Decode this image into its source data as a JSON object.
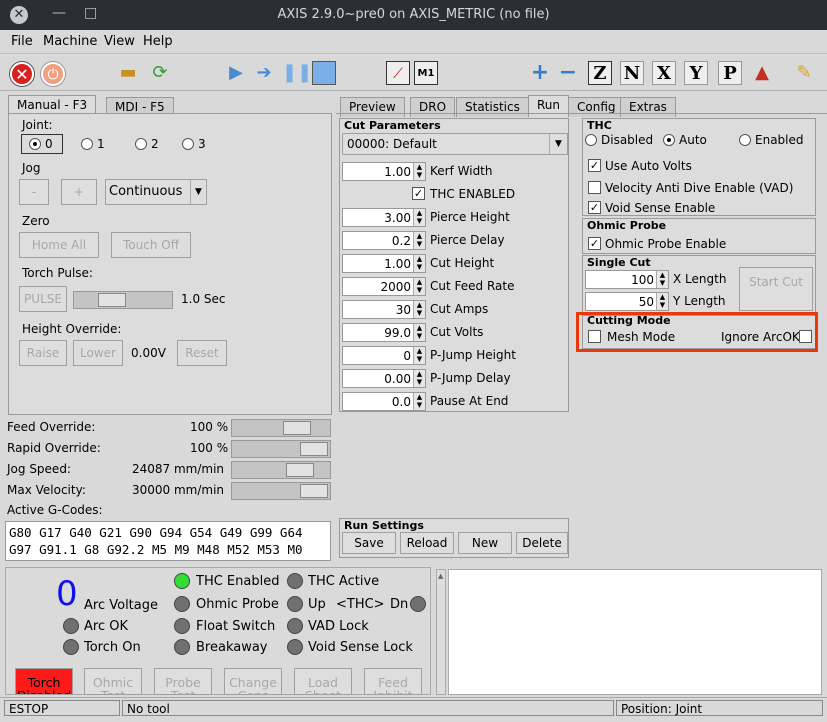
{
  "window": {
    "title": "AXIS 2.9.0~pre0 on AXIS_METRIC (no file)"
  },
  "menu": [
    "File",
    "Machine",
    "View",
    "Help"
  ],
  "toolbar": {
    "icons": [
      "estop-icon",
      "power-icon",
      "open-icon",
      "reload-icon",
      "run-icon",
      "step-icon",
      "pause-icon",
      "stop-icon",
      "touchoff-icon",
      "ml-icon",
      "zoom-in-icon",
      "zoom-out-icon",
      "view-z-icon",
      "view-z2-icon",
      "view-x-icon",
      "view-y-icon",
      "view-p-icon",
      "rotate-icon",
      "clear-icon"
    ],
    "view_labels": {
      "z": "Z",
      "z2": "N",
      "x": "X",
      "y": "Y",
      "p": "P"
    }
  },
  "left_tabs": [
    "Manual - F3",
    "MDI - F5"
  ],
  "manual": {
    "joint_label": "Joint:",
    "joints": [
      "0",
      "1",
      "2",
      "3"
    ],
    "jog_label": "Jog",
    "jog_minus": "-",
    "jog_plus": "+",
    "jog_mode": "Continuous",
    "zero_label": "Zero",
    "home_all": "Home All",
    "touch_off": "Touch Off",
    "torch_pulse_label": "Torch Pulse:",
    "pulse": "PULSE",
    "pulse_time": "1.0 Sec",
    "height_override_label": "Height Override:",
    "raise": "Raise",
    "lower": "Lower",
    "override_value": "0.00V",
    "reset": "Reset"
  },
  "overrides": [
    {
      "label": "Feed Override:",
      "value": "100 %",
      "level": 0.75
    },
    {
      "label": "Rapid Override:",
      "value": "100 %",
      "level": 1.0
    },
    {
      "label": "Jog Speed:",
      "value": "24087 mm/min",
      "level": 0.8
    },
    {
      "label": "Max Velocity:",
      "value": "30000 mm/min",
      "level": 1.0
    }
  ],
  "gcodes": {
    "label": "Active G-Codes:",
    "line1": "G80 G17 G40 G21 G90 G94 G54 G49 G99 G64",
    "line2": "G97 G91.1 G8 G92.2 M5 M9 M48 M52 M53 M0"
  },
  "right_tabs": [
    "Preview",
    "DRO",
    "Statistics",
    "Run",
    "Config",
    "Extras"
  ],
  "cut_params": {
    "title": "Cut Parameters",
    "material": "00000: Default",
    "rows": [
      {
        "value": "1.00",
        "label": "Kerf Width"
      },
      {
        "value": "",
        "label": "THC ENABLED",
        "checkbox": true
      },
      {
        "value": "3.00",
        "label": "Pierce Height"
      },
      {
        "value": "0.2",
        "label": "Pierce Delay"
      },
      {
        "value": "1.00",
        "label": "Cut Height"
      },
      {
        "value": "2000",
        "label": "Cut Feed Rate"
      },
      {
        "value": "30",
        "label": "Cut Amps"
      },
      {
        "value": "99.0",
        "label": "Cut Volts"
      },
      {
        "value": "0",
        "label": "P-Jump Height"
      },
      {
        "value": "0.00",
        "label": "P-Jump Delay"
      },
      {
        "value": "0.0",
        "label": "Pause At End"
      }
    ]
  },
  "run_settings": {
    "title": "Run Settings",
    "buttons": [
      "Save",
      "Reload",
      "New",
      "Delete"
    ]
  },
  "thc": {
    "title": "THC",
    "modes": [
      "Disabled",
      "Auto",
      "Enabled"
    ],
    "selected": "Auto",
    "options": [
      "Use Auto Volts",
      "Velocity Anti Dive Enable (VAD)",
      "Void Sense Enable"
    ],
    "checked": [
      true,
      false,
      true
    ]
  },
  "ohmic": {
    "title": "Ohmic Probe",
    "option": "Ohmic Probe Enable"
  },
  "single_cut": {
    "title": "Single Cut",
    "x_value": "100",
    "x_label": "X Length",
    "y_value": "50",
    "y_label": "Y Length",
    "button": "Start Cut"
  },
  "cutting_mode": {
    "title": "Cutting Mode",
    "mesh": "Mesh Mode",
    "ignore": "Ignore ArcOK",
    "highlight_color": "#e8380d"
  },
  "status_panel": {
    "arc_voltage_value": "0",
    "arc_voltage_label": "Arc Voltage",
    "arc_ok": "Arc OK",
    "torch_on": "Torch On",
    "thc_enabled": "THC Enabled",
    "ohmic_probe": "Ohmic Probe",
    "float_switch": "Float Switch",
    "breakaway": "Breakaway",
    "thc_active": "THC Active",
    "up": "Up",
    "thc_label": "<THC>",
    "dn": "Dn",
    "vad_lock": "VAD Lock",
    "void_lock": "Void Sense Lock"
  },
  "bottom_buttons": [
    "Torch Disabled",
    "Ohmic Test",
    "Probe Test",
    "Change Cons",
    "Load Sheet",
    "Feed Inhibit"
  ],
  "statusbar": {
    "estop": "ESTOP",
    "tool": "No tool",
    "position": "Position: Joint"
  },
  "colors": {
    "torch_button": "#ff1a1a",
    "led_on": "#33dd33",
    "arc_voltage": "#1010ee"
  }
}
